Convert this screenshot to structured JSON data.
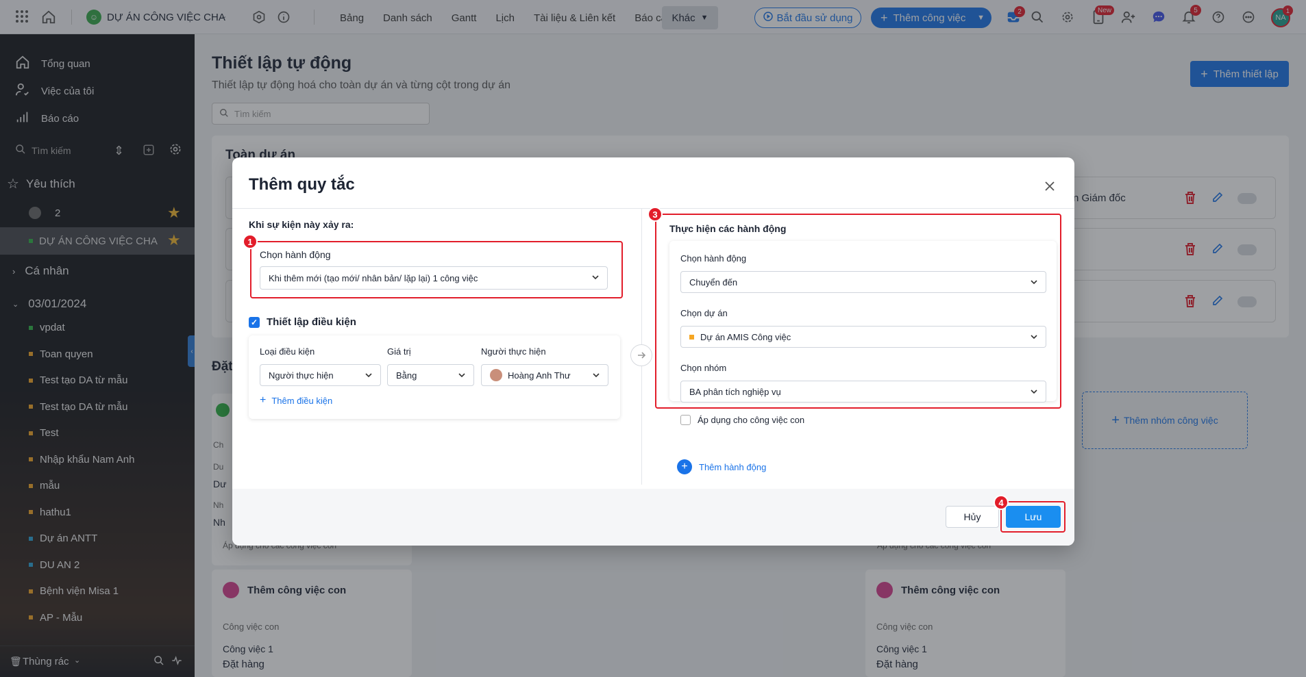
{
  "topbar": {
    "project_title": "DỰ ÁN CÔNG VIỆC CHA",
    "nav": [
      "Bảng",
      "Danh sách",
      "Gantt",
      "Lịch",
      "Tài liệu & Liên kết",
      "Báo cáo"
    ],
    "more_label": "Khác",
    "start_label": "Bắt đầu sử dụng",
    "add_task_label": "Thêm công việc",
    "inbox_badge": "2",
    "new_badge": "New",
    "notif_badge": "5",
    "avatar_initials": "NA",
    "avatar_badge": "1"
  },
  "sidebar": {
    "overview": "Tổng quan",
    "my_tasks": "Việc của tôi",
    "reports": "Báo cáo",
    "search_placeholder": "Tìm kiếm",
    "favorites": "Yêu thích",
    "fav_items": [
      {
        "label": "2"
      },
      {
        "label": "DỰ ÁN CÔNG VIỆC CHA"
      }
    ],
    "personal": "Cá nhân",
    "date_group": "03/01/2024",
    "projects": [
      {
        "label": "vpdat",
        "color": "#2fb344"
      },
      {
        "label": "Toan quyen",
        "color": "#f5a623"
      },
      {
        "label": "Test tạo DA từ mẫu",
        "color": "#f5a623"
      },
      {
        "label": "Test tạo DA từ mẫu",
        "color": "#f5a623"
      },
      {
        "label": "Test",
        "color": "#f5a623"
      },
      {
        "label": "Nhập khẩu Nam Anh",
        "color": "#f5a623"
      },
      {
        "label": "mẫu",
        "color": "#f5a623"
      },
      {
        "label": "hathu1",
        "color": "#f5a623"
      },
      {
        "label": "Dự án ANTT",
        "color": "#2aa3d6"
      },
      {
        "label": "DU AN 2",
        "color": "#2aa3d6"
      },
      {
        "label": "Bệnh viện Misa 1",
        "color": "#f5a623"
      },
      {
        "label": "AP - Mẫu",
        "color": "#f5a623"
      }
    ],
    "trash": "Thùng rác"
  },
  "page": {
    "title": "Thiết lập tự động",
    "subtitle": "Thiết lập tự động hoá cho toàn dự án và từng cột trong dự án",
    "search_placeholder": "Tìm kiếm",
    "add_setup": "Thêm thiết lập",
    "section_project": "Toàn dự án",
    "rule_partial": "n Giám đốc",
    "section_partial": "Đặt",
    "add_group": "Thêm nhóm công việc",
    "bg_card_ch": "Ch",
    "bg_card_du": "Du",
    "bg_card_du2": "Dư",
    "bg_card_nh": "Nh",
    "bg_card_nh2": "Nh",
    "apply_sub_left": "Áp dụng cho các công việc con",
    "apply_sub_right": "Áp dụng cho các công việc con",
    "subtask_card_title": "Thêm công việc con",
    "subtask_label": "Công việc con",
    "subtask_item": "Công việc 1",
    "subtask_status": "Đặt hàng"
  },
  "modal": {
    "title": "Thêm quy tắc",
    "when_label": "Khi sự kiện này xảy ra:",
    "choose_action_label": "Chọn hành động",
    "trigger_value": "Khi thêm mới (tạo mới/ nhân bản/ lặp lại) 1 công việc",
    "condition_checkbox": "Thiết lập điều kiện",
    "cond_type_label": "Loại điều kiện",
    "cond_value_label": "Giá trị",
    "cond_person_label": "Người thực hiện",
    "cond_type_value": "Người thực hiện",
    "cond_value_value": "Bằng",
    "cond_person_value": "Hoàng Anh Thư",
    "add_condition": "Thêm điều kiện",
    "do_actions_label": "Thực hiện các hành động",
    "action_label": "Chọn hành động",
    "action_value": "Chuyển đến",
    "project_label": "Chọn dự án",
    "project_value": "Dự án AMIS Công việc",
    "group_label": "Chọn nhóm",
    "group_value": "BA phân tích nghiệp vụ",
    "apply_children": "Áp dụng cho công việc con",
    "add_action": "Thêm hành động",
    "cancel": "Hủy",
    "save": "Lưu",
    "badges": [
      "1",
      "3",
      "4"
    ]
  }
}
